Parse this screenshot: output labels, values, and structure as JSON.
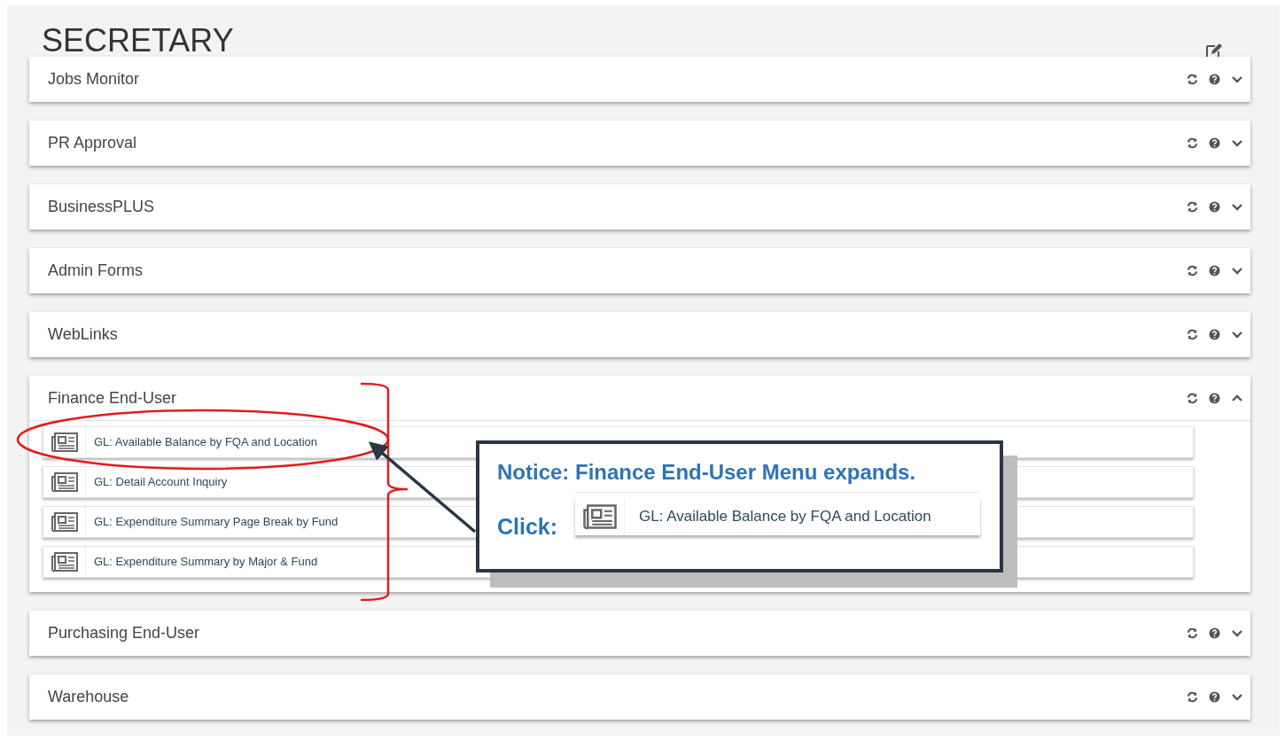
{
  "page_title": "SECRETARY",
  "panels": [
    {
      "label": "Jobs Monitor",
      "expanded": false
    },
    {
      "label": "PR Approval",
      "expanded": false
    },
    {
      "label": "BusinessPLUS",
      "expanded": false
    },
    {
      "label": "Admin Forms",
      "expanded": false
    },
    {
      "label": "WebLinks",
      "expanded": false
    },
    {
      "label": "Finance End-User",
      "expanded": true,
      "items": [
        {
          "label": "GL: Available Balance by FQA and Location"
        },
        {
          "label": "GL: Detail Account Inquiry"
        },
        {
          "label": "GL: Expenditure Summary Page Break by Fund"
        },
        {
          "label": "GL: Expenditure Summary by Major & Fund"
        }
      ]
    },
    {
      "label": "Purchasing End-User",
      "expanded": false
    },
    {
      "label": "Warehouse",
      "expanded": false
    }
  ],
  "callout": {
    "notice": "Notice: Finance End-User Menu expands.",
    "click_label": "Click:",
    "click_item": "GL: Available Balance by FQA and Location"
  }
}
